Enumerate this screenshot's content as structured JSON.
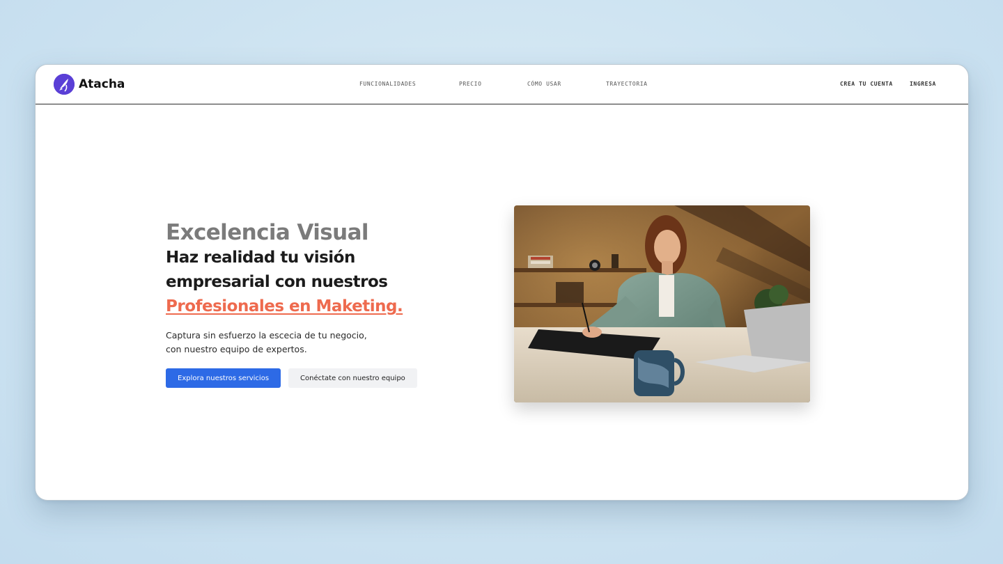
{
  "brand": {
    "name": "Atacha",
    "logo_icon": "rocket-icon",
    "accent_color": "#5a3fd6"
  },
  "nav": {
    "links": [
      "FUNCIONALIDADES",
      "PRECIO",
      "CÓMO USAR",
      "TRAYECTORIA"
    ],
    "create_account": "CREA TU CUENTA",
    "login": "INGRESA"
  },
  "hero": {
    "eyebrow": "Excelencia Visual",
    "headline_line1": "Haz realidad tu visión",
    "headline_line2": "empresarial con nuestros",
    "headline_accent": "Profesionales en Maketing.",
    "subtext_line1": "Captura sin esfuerzo la escecia de tu negocio,",
    "subtext_line2": "con nuestro equipo de expertos.",
    "primary_cta": "Explora nuestros servicios",
    "secondary_cta": "Conéctate con nuestro equipo",
    "accent_color": "#ee6a4e",
    "primary_color": "#2d6ae6"
  }
}
